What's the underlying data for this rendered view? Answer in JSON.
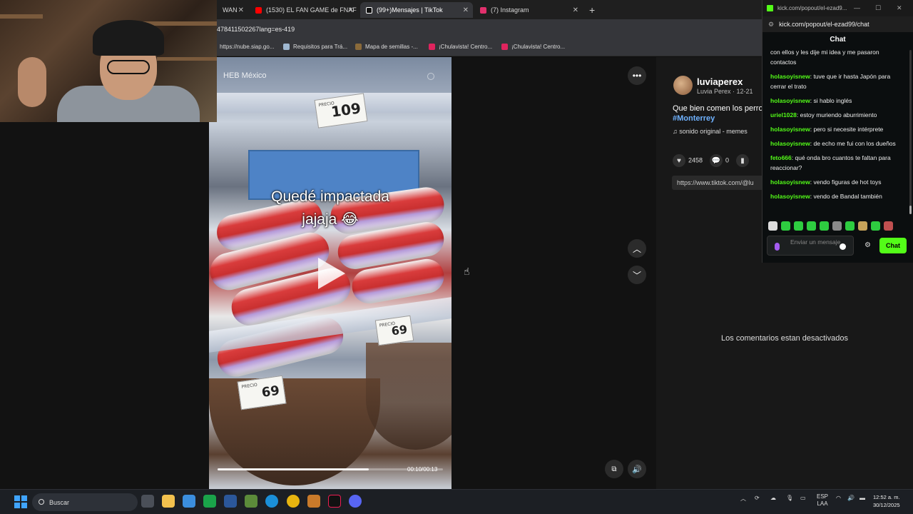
{
  "browser": {
    "tabs": [
      {
        "label": "WAN",
        "color": "#888888",
        "active": false
      },
      {
        "label": "(1530) EL FAN GAME de FNAF",
        "color": "#ff0000",
        "active": false
      },
      {
        "label": "(99+)Mensajes | TikTok",
        "color": "#ffffff",
        "active": true
      },
      {
        "label": "(7) Instagram",
        "color": "#e1306c",
        "active": false
      }
    ],
    "url": "478411502267lang=es-419",
    "bookmarks": [
      {
        "label": "https://nube.siap.go...",
        "color": "#777777"
      },
      {
        "label": "Requisitos para Trá...",
        "color": "#9fb7d0"
      },
      {
        "label": "Mapa de semillas -...",
        "color": "#8a6a3a"
      },
      {
        "label": "¡Chulavista! Centro...",
        "color": "#e0245e"
      },
      {
        "label": "¡Chulavista! Centro...",
        "color": "#e0245e"
      }
    ]
  },
  "video": {
    "account_overlay": "HEB México",
    "caption_line1": "Quedé impactada",
    "caption_line2": "jajaja 😂",
    "timecode": "00:10/00:13",
    "progress_fraction": 0.67,
    "price_tags": [
      "109",
      "69",
      "69"
    ]
  },
  "post": {
    "username": "luviaperex",
    "subname": "Luvia Perex · 12-21",
    "description": "Que bien comen los perro",
    "hashtag": "#Monterrey",
    "sound": "sonido original - memes",
    "likes": "2458",
    "comments": "0",
    "link": "https://www.tiktok.com/@lu",
    "comments_disabled": "Los comentarios estan desactivados"
  },
  "chat": {
    "popup_title": "kick.com/popout/el-ezad9...",
    "url": "kick.com/popout/el-ezad99/chat",
    "header": "Chat",
    "messages": [
      {
        "user": "",
        "text": "con ellos y les dije mi idea y me pasaron contactos",
        "color": "#53fc18"
      },
      {
        "user": "holasoyisnew",
        "text": ": tuve que ir hasta Japón para cerrar el trato",
        "color": "#53fc18"
      },
      {
        "user": "holasoyisnew",
        "text": ": si hablo inglés",
        "color": "#53fc18"
      },
      {
        "user": "uriel1028",
        "text": ": estoy muriendo aburrimiento",
        "color": "#53fc18"
      },
      {
        "user": "holasoyisnew",
        "text": ": pero si necesite intérprete",
        "color": "#53fc18"
      },
      {
        "user": "holasoyisnew",
        "text": ": de echo me fui con los dueños",
        "color": "#53fc18"
      },
      {
        "user": "feto666",
        "text": ": qué onda bro cuantos te faltan para reaccionar?",
        "color": "#53fc18"
      },
      {
        "user": "holasoyisnew",
        "text": ": vendo figuras de hot toys",
        "color": "#53fc18"
      },
      {
        "user": "holasoyisnew",
        "text": ": vendo de Bandal también",
        "color": "#53fc18"
      }
    ],
    "input_placeholder": "Enviar un mensaje",
    "send_label": "Chat"
  },
  "taskbar": {
    "search_label": "Buscar",
    "lang_line1": "ESP",
    "lang_line2": "LAA",
    "time": "12:52 a. m.",
    "date": "30/12/2025"
  }
}
